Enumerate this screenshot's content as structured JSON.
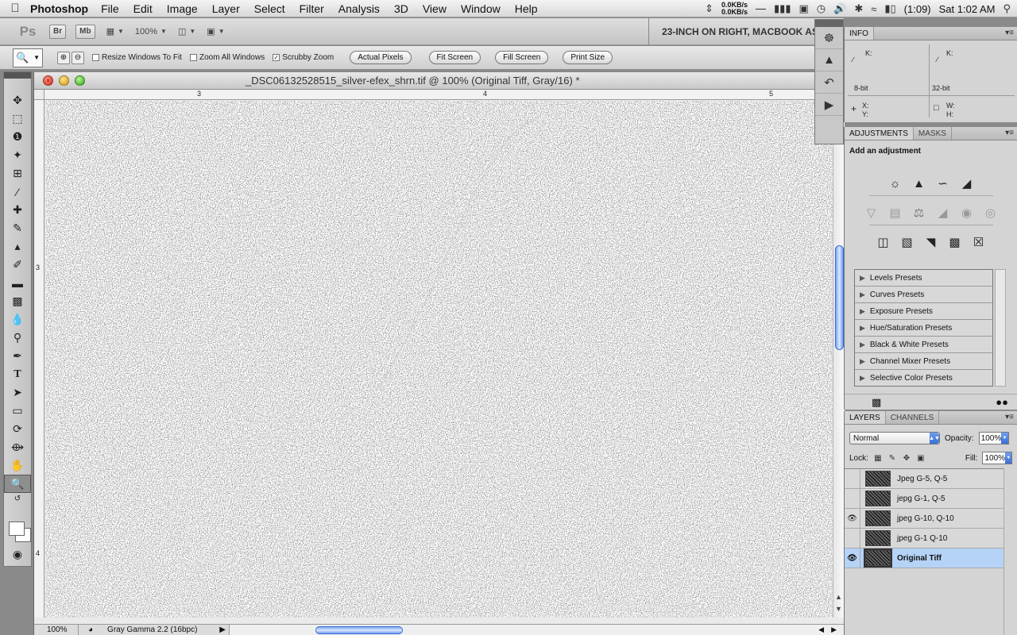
{
  "menubar": {
    "app_name": "Photoshop",
    "menus": [
      "File",
      "Edit",
      "Image",
      "Layer",
      "Select",
      "Filter",
      "Analysis",
      "3D",
      "View",
      "Window",
      "Help"
    ],
    "net_up": "0.0KB/s",
    "net_down": "0.0KB/s",
    "battery": "(1:09)",
    "clock": "Sat 1:02 AM"
  },
  "appbar": {
    "ps_logo": "Ps",
    "bridge_label": "Br",
    "minibridge_label": "Mb",
    "zoom_level": "100%",
    "workspace": "23-INCH ON RIGHT, MACBOOK AS"
  },
  "options": {
    "resize_windows": {
      "label": "Resize Windows To Fit",
      "checked": false
    },
    "zoom_all": {
      "label": "Zoom All Windows",
      "checked": false
    },
    "scrubby": {
      "label": "Scrubby Zoom",
      "checked": true
    },
    "actual_pixels": "Actual Pixels",
    "fit_screen": "Fit Screen",
    "fill_screen": "Fill Screen",
    "print_size": "Print Size"
  },
  "document": {
    "title": "_DSC06132528515_silver-efex_shrn.tif @ 100% (Original Tiff, Gray/16) *",
    "ruler_h": [
      "3",
      "4",
      "5"
    ],
    "ruler_v": [
      "3",
      "4"
    ],
    "zoom": "100%",
    "doc_info": "Gray Gamma 2.2 (16bpc)"
  },
  "info_panel": {
    "tab": "INFO",
    "k_left": "K:",
    "k_right": "K:",
    "bit_left": "8-bit",
    "bit_right": "32-bit",
    "x": "X:",
    "y": "Y:",
    "w": "W:",
    "h": "H:"
  },
  "adjustments_panel": {
    "tabs": [
      "ADJUSTMENTS",
      "MASKS"
    ],
    "heading": "Add an adjustment",
    "presets": [
      "Levels Presets",
      "Curves Presets",
      "Exposure Presets",
      "Hue/Saturation Presets",
      "Black & White Presets",
      "Channel Mixer Presets",
      "Selective Color Presets"
    ]
  },
  "layers_panel": {
    "tabs": [
      "LAYERS",
      "CHANNELS"
    ],
    "blend_mode": "Normal",
    "opacity_label": "Opacity:",
    "opacity": "100%",
    "lock_label": "Lock:",
    "fill_label": "Fill:",
    "fill": "100%",
    "layers": [
      {
        "name": "Jpeg G-5, Q-5",
        "visible": false,
        "selected": false
      },
      {
        "name": "jepg G-1, Q-5",
        "visible": false,
        "selected": false
      },
      {
        "name": "jpeg G-10, Q-10",
        "visible": true,
        "selected": false
      },
      {
        "name": "jpeg G-1 Q-10",
        "visible": false,
        "selected": false
      },
      {
        "name": "Original Tiff",
        "visible": true,
        "selected": true
      }
    ]
  },
  "colors": {
    "accent_blue": "#3c6bd1",
    "selected_layer": "#b5d3f7"
  }
}
